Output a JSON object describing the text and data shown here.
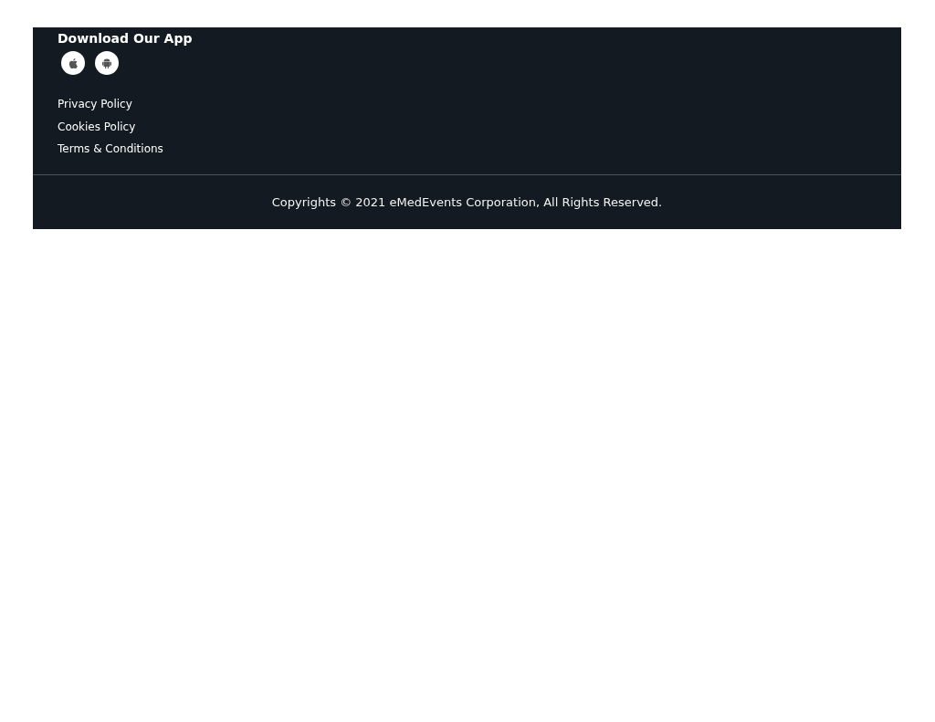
{
  "footer": {
    "app_heading": "Download Our App",
    "app_buttons": [
      {
        "kind": "apple"
      },
      {
        "kind": "android"
      }
    ],
    "links": [
      "Privacy Policy",
      "Cookies Policy",
      "Terms & Conditions"
    ],
    "copyright": "Copyrights © 2021 eMedEvents Corporation, All Rights Reserved."
  }
}
